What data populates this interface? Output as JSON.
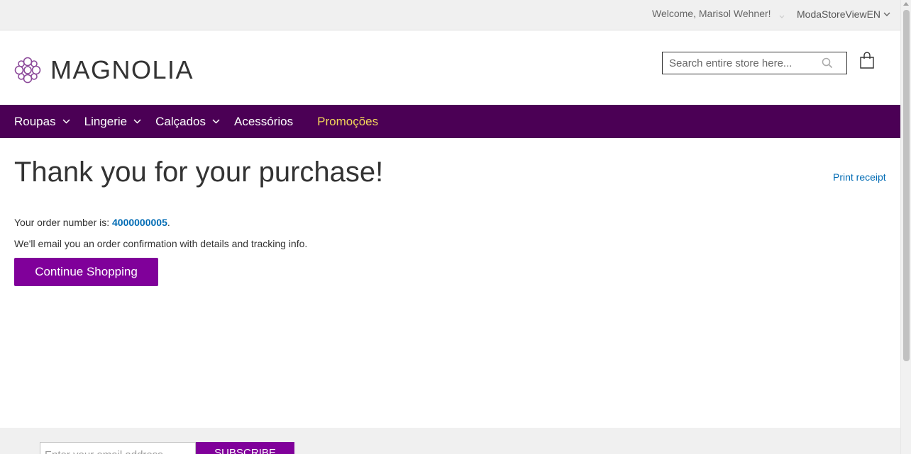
{
  "top_panel": {
    "welcome": "Welcome, Marisol Wehner!",
    "store_view": "ModaStoreViewEN"
  },
  "header": {
    "logo_text": "MAGNOLIA",
    "search_placeholder": "Search entire store here...",
    "icons": {
      "search": "search-icon",
      "cart": "cart-icon"
    }
  },
  "nav": {
    "items": [
      {
        "label": "Roupas",
        "has_dropdown": true
      },
      {
        "label": "Lingerie",
        "has_dropdown": true
      },
      {
        "label": "Calçados",
        "has_dropdown": true
      },
      {
        "label": "Acessórios",
        "has_dropdown": false
      },
      {
        "label": "Promoções",
        "has_dropdown": false
      }
    ]
  },
  "main": {
    "title": "Thank you for your purchase!",
    "print_receipt": "Print receipt",
    "order_prefix": "Your order number is: ",
    "order_number": "4000000005",
    "order_suffix": ".",
    "email_message": "We'll email you an order confirmation with details and tracking info.",
    "continue_button": "Continue Shopping"
  },
  "footer": {
    "newsletter_placeholder": "Enter your email address",
    "subscribe_button": "SUBSCRIBE"
  },
  "colors": {
    "nav_bg": "#4b0055",
    "button_bg": "#80009a",
    "promo_text": "#f3d65a",
    "link": "#006bb4"
  }
}
